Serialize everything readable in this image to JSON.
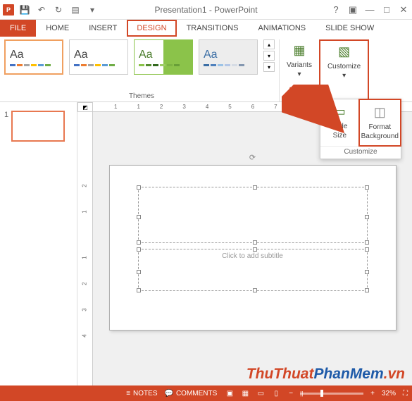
{
  "titlebar": {
    "app": "P",
    "title": "Presentation1 - PowerPoint",
    "help": "?",
    "ribbon_opts": "▣",
    "minimize": "—",
    "restore": "□",
    "close": "✕"
  },
  "tabs": {
    "file": "FILE",
    "home": "HOME",
    "insert": "INSERT",
    "design": "DESIGN",
    "transitions": "TRANSITIONS",
    "animations": "ANIMATIONS",
    "slideshow": "SLIDE SHOW"
  },
  "ribbon": {
    "themes_label": "Themes",
    "theme_glyph": "Aa",
    "variants": "Variants",
    "customize": "Customize"
  },
  "dropdown": {
    "slide_size": "Slide\nSize",
    "format_bg": "Format\nBackground",
    "label": "Customize"
  },
  "ruler_h": [
    "1",
    "1",
    "2",
    "3",
    "4",
    "5",
    "6",
    "7"
  ],
  "ruler_v": [
    "2",
    "1",
    "",
    "1",
    "2",
    "3",
    "4"
  ],
  "slides": {
    "num": "1"
  },
  "placeholder": {
    "subtitle": "Click to add subtitle"
  },
  "watermark": {
    "p1": "ThuThuat",
    "p2": "PhanMem",
    "p3": ".vn"
  },
  "status": {
    "notes": "NOTES",
    "comments": "COMMENTS",
    "zoom": "32%"
  }
}
